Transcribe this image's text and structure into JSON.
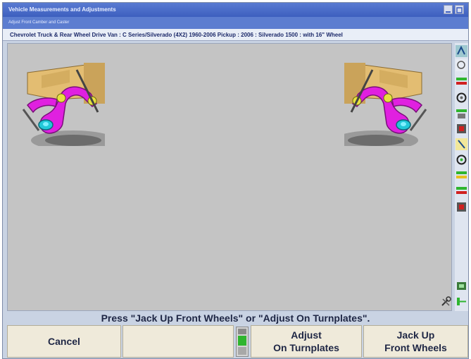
{
  "window": {
    "title": "Vehicle Measurements and Adjustments",
    "subtitle": "Adjust Front Camber and Caster"
  },
  "vehicle": {
    "description": "Chevrolet Truck & Rear Wheel Drive Van : C Series/Silverado (4X2) 1960-2006 Pickup : 2006 : Silverado 1500 : with 16\" Wheel"
  },
  "main": {
    "left_image": "control-arm-image",
    "right_image": "control-arm-image",
    "corner_icon": "wrench-icon"
  },
  "status": {
    "message": "Press \"Jack Up Front Wheels\" or \"Adjust On Turnplates\"."
  },
  "buttons": {
    "cancel_label": "Cancel",
    "blank_label": "",
    "adjust_line1": "Adjust",
    "adjust_line2": "On Turnplates",
    "jack_line1": "Jack Up",
    "jack_line2": "Front Wheels"
  },
  "sidebar": {
    "icons": [
      "align-icon",
      "vehicle-icon",
      "wheel-icon",
      "measure-icon",
      "tire-icon",
      "adjust-icon",
      "wheel-icon",
      "measure-icon",
      "tire-icon",
      "adjust-icon",
      "sensor-icon",
      "connector-icon"
    ]
  },
  "colors": {
    "arm": "#e020e0",
    "bracket": "#e8c27a",
    "button_bg": "#efeada",
    "gauge_green": "#2fb52f"
  }
}
